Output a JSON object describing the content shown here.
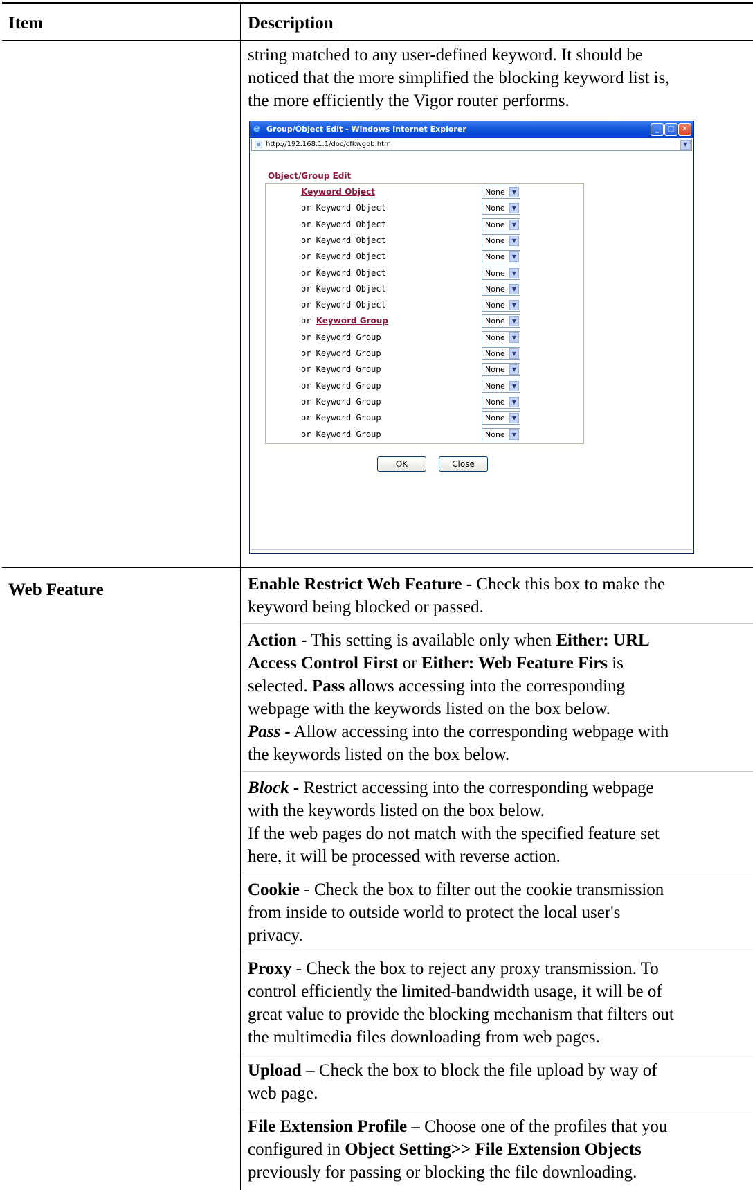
{
  "table": {
    "header_item": "Item",
    "header_description": "Description",
    "row2_item": "Web Feature"
  },
  "intro_text": {
    "line1": "string matched to any user-defined keyword. It should be",
    "line2": "noticed that the more simplified the blocking keyword list is,",
    "line3": "the more efficiently the Vigor router performs."
  },
  "window": {
    "title": "Group/Object Edit - Windows Internet Explorer",
    "address": "http://192.168.1.1/doc/cfkwgob.htm",
    "section_title": "Object/Group Edit",
    "rows": [
      {
        "prefix": "",
        "label": "Keyword Object",
        "link": true,
        "value": "None"
      },
      {
        "prefix": "",
        "label": "or Keyword Object",
        "link": false,
        "value": "None"
      },
      {
        "prefix": "",
        "label": "or Keyword Object",
        "link": false,
        "value": "None"
      },
      {
        "prefix": "",
        "label": "or Keyword Object",
        "link": false,
        "value": "None"
      },
      {
        "prefix": "",
        "label": "or Keyword Object",
        "link": false,
        "value": "None"
      },
      {
        "prefix": "",
        "label": "or Keyword Object",
        "link": false,
        "value": "None"
      },
      {
        "prefix": "",
        "label": "or Keyword Object",
        "link": false,
        "value": "None"
      },
      {
        "prefix": "",
        "label": "or Keyword Object",
        "link": false,
        "value": "None"
      },
      {
        "prefix": "or ",
        "label": "Keyword Group",
        "link": true,
        "value": "None"
      },
      {
        "prefix": "",
        "label": "or Keyword Group",
        "link": false,
        "value": "None"
      },
      {
        "prefix": "",
        "label": "or Keyword Group",
        "link": false,
        "value": "None"
      },
      {
        "prefix": "",
        "label": "or Keyword Group",
        "link": false,
        "value": "None"
      },
      {
        "prefix": "",
        "label": "or Keyword Group",
        "link": false,
        "value": "None"
      },
      {
        "prefix": "",
        "label": "or Keyword Group",
        "link": false,
        "value": "None"
      },
      {
        "prefix": "",
        "label": "or Keyword Group",
        "link": false,
        "value": "None"
      },
      {
        "prefix": "",
        "label": "or Keyword Group",
        "link": false,
        "value": "None"
      }
    ],
    "ok_label": "OK",
    "close_label": "Close"
  },
  "web_feature": {
    "enable_term": "Enable Restrict Web Feature -",
    "enable_l1": " Check this box to make the",
    "enable_l2": "keyword being blocked or passed.",
    "action_term": "Action -",
    "action_l1a": " This setting is available only when ",
    "action_l1b": "Either: URL",
    "action_l2a": "Access Control First",
    "action_l2b": " or ",
    "action_l2c": "Either: Web Feature Firs",
    "action_l2d": " is",
    "action_l3a": "selected. ",
    "action_l3b": "Pass",
    "action_l3c": " allows accessing into the corresponding",
    "action_l4": "webpage with the keywords listed on the box below.",
    "pass_term": "Pass -",
    "pass_l1": " Allow accessing into the corresponding webpage with",
    "pass_l2": "the keywords listed on the box below.",
    "block_term": "Block -",
    "block_l1": " Restrict accessing into the corresponding webpage",
    "block_l2": "with the keywords listed on the box below.",
    "block_l3": "If the web pages do not match with the specified feature set",
    "block_l4": "here, it will be processed with reverse action.",
    "cookie_term": "Cookie",
    "cookie_l1": " - Check the box to filter out the cookie transmission",
    "cookie_l2": "from inside to outside world to protect the local user's",
    "cookie_l3": "privacy.",
    "proxy_term": "Proxy",
    "proxy_l1": " - Check the box to reject any proxy transmission. To",
    "proxy_l2": "control efficiently the limited-bandwidth usage, it will be of",
    "proxy_l3": "great value to provide the blocking mechanism that filters out",
    "proxy_l4": "the multimedia files downloading from web pages.",
    "upload_term": "Upload",
    "upload_l1": " – Check the box to block the file upload by way of",
    "upload_l2": "web page.",
    "fep_term": "File Extension Profile –",
    "fep_l1": " Choose one of the profiles that you",
    "fep_l2a": "configured in ",
    "fep_l2b": "Object Setting>> File Extension Objects",
    "fep_l3": "previously for passing or blocking the file downloading."
  }
}
